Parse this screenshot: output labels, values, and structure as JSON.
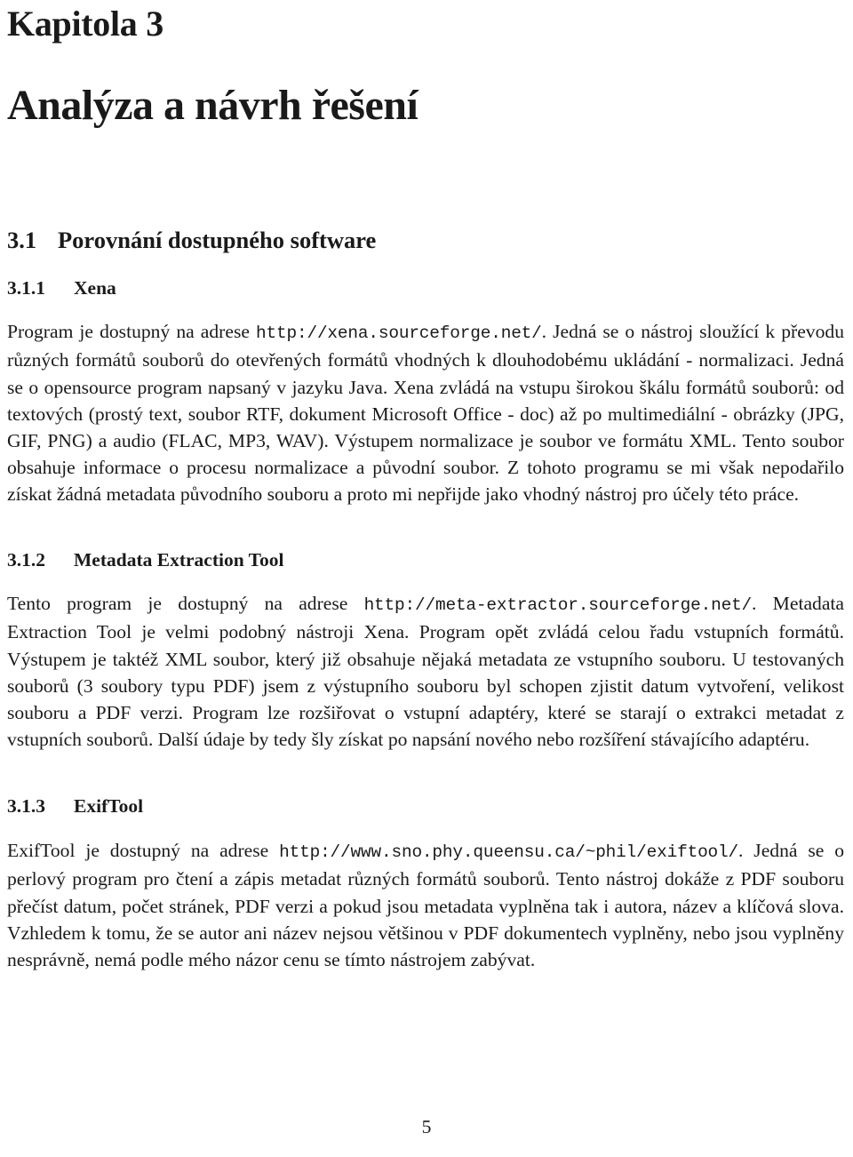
{
  "document": {
    "page_number": "5",
    "language": "cs"
  },
  "chapter": {
    "number_label": "Kapitola 3",
    "title": "Analýza a návrh řešení"
  },
  "sections": {
    "s31": {
      "number": "3.1",
      "title": "Porovnání dostupného software"
    },
    "s311": {
      "number": "3.1.1",
      "title": "Xena",
      "paragraph": {
        "lead": "Program je dostupný na adrese ",
        "url": "http://xena.sourceforge.net/",
        "rest": ". Jedná se o nástroj sloužící k převodu různých formátů souborů do otevřených formátů vhodných k dlouhodobému ukládání - normalizaci. Jedná se o opensource program napsaný v jazyku Java. Xena zvládá na vstupu širokou škálu formátů souborů: od textových (prostý text, soubor RTF, dokument Microsoft Office - doc) až po multimediální - obrázky (JPG, GIF, PNG) a audio (FLAC, MP3, WAV). Výstupem normalizace je soubor ve formátu XML. Tento soubor obsahuje informace o procesu normalizace a původní soubor. Z tohoto programu se mi však nepodařilo získat žádná metadata původního souboru a proto mi nepřijde jako vhodný nástroj pro účely této práce."
      }
    },
    "s312": {
      "number": "3.1.2",
      "title": "Metadata Extraction Tool",
      "paragraph": {
        "lead": "Tento program je dostupný na adrese ",
        "url": "http://meta-extractor.sourceforge.net/",
        "rest": ". Metadata Extraction Tool je velmi podobný nástroji Xena. Program opět zvládá celou řadu vstupních formátů. Výstupem je taktéž XML soubor, který již obsahuje nějaká metadata ze vstupního souboru. U testovaných souborů (3 soubory typu PDF) jsem z výstupního souboru byl schopen zjistit datum vytvoření, velikost souboru a PDF verzi. Program lze rozšiřovat o vstupní adaptéry, které se starají o extrakci metadat z vstupních souborů. Další údaje by tedy šly získat po napsání nového nebo rozšíření stávajícího adaptéru."
      }
    },
    "s313": {
      "number": "3.1.3",
      "title": "ExifTool",
      "paragraph": {
        "lead": "ExifTool je dostupný na adrese ",
        "url": "http://www.sno.phy.queensu.ca/~phil/exiftool/",
        "rest": ". Jedná se o perlový program pro čtení a zápis metadat různých formátů souborů. Tento nástroj dokáže z PDF souboru přečíst datum, počet stránek, PDF verzi a pokud jsou metadata vyplněna tak i autora, název a klíčová slova. Vzhledem k tomu, že se autor ani název nejsou většinou v PDF dokumentech vyplněny, nebo jsou vyplněny nesprávně, nemá podle mého názor cenu se tímto nástrojem zabývat."
      }
    }
  }
}
